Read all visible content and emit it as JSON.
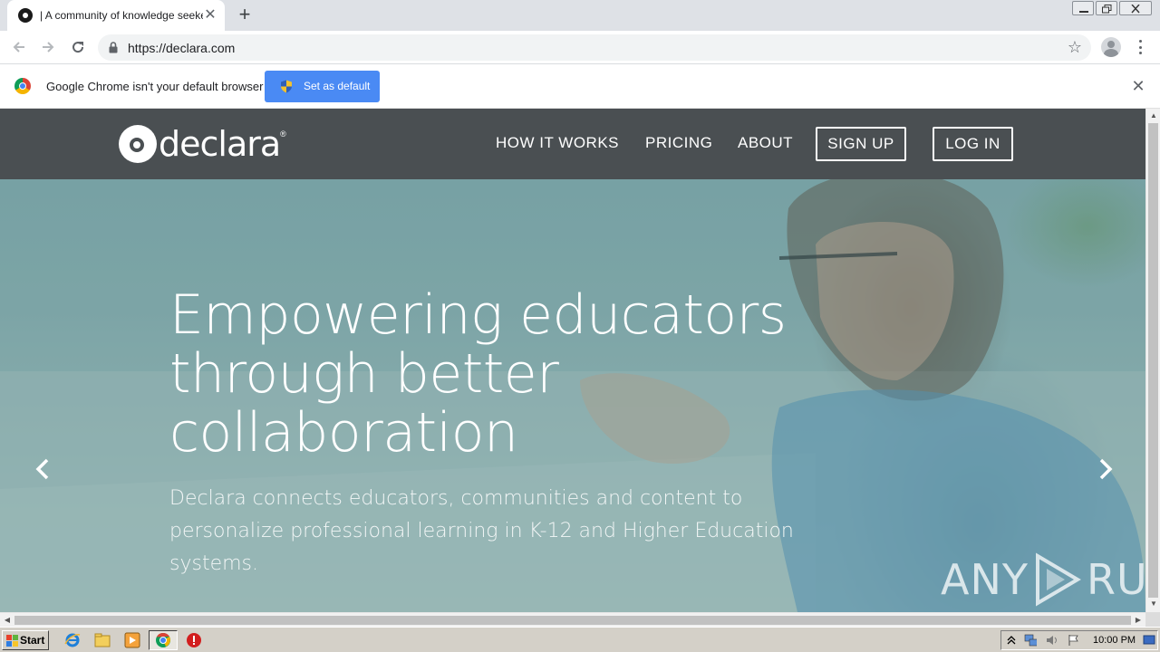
{
  "browser": {
    "tab": {
      "title": "| A community of knowledge seekers",
      "close_glyph": "✕"
    },
    "new_tab_glyph": "+",
    "window_controls": [
      "minimize",
      "restore",
      "close"
    ],
    "address": {
      "url": "https://declara.com",
      "secure": true
    },
    "bookmark_glyph": "☆",
    "infobar": {
      "message": "Google Chrome isn't your default browser",
      "button_label": "Set as default",
      "close_glyph": "✕"
    }
  },
  "site": {
    "logo_text": "declara",
    "logo_reg": "®",
    "nav": {
      "how_it_works": "HOW IT WORKS",
      "pricing": "PRICING",
      "about": "ABOUT",
      "sign_up": "SIGN UP",
      "log_in": "LOG IN"
    },
    "hero": {
      "headline_lines": [
        "Empowering educators",
        "through better",
        "collaboration"
      ],
      "subtext": "Declara connects educators, communities and content to personalize professional learning in K-12 and Higher Education systems."
    },
    "watermark": {
      "left": "ANY",
      "right": "RUN"
    }
  },
  "taskbar": {
    "start_label": "Start",
    "clock": "10:00 PM"
  },
  "colors": {
    "nav_bg": "#4a4f52",
    "accent_button": "#4a8af4",
    "tabstrip": "#dee1e6"
  }
}
